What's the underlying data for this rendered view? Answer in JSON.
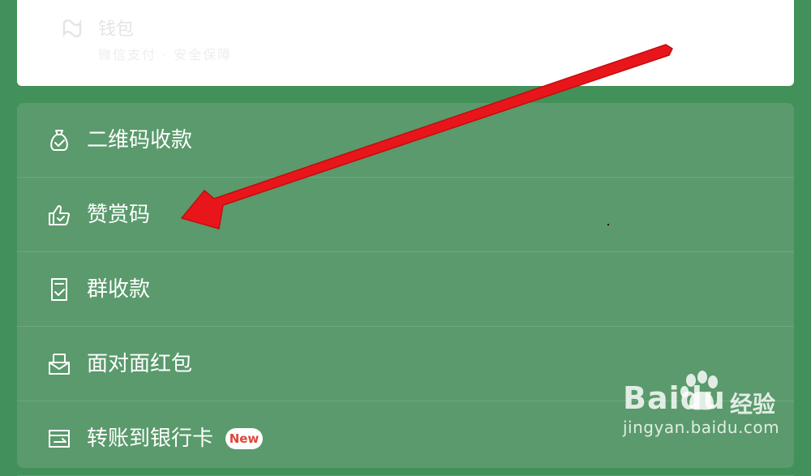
{
  "top_card": {
    "title": "钱包",
    "subtitle": "微信支付  ·  安全保障"
  },
  "menu": {
    "items": [
      {
        "label": "二维码收款",
        "icon": "money-bag-icon"
      },
      {
        "label": "赞赏码",
        "icon": "thumbs-up-icon"
      },
      {
        "label": "群收款",
        "icon": "receipt-check-icon"
      },
      {
        "label": "面对面红包",
        "icon": "red-envelope-icon"
      },
      {
        "label": "转账到银行卡",
        "icon": "bank-transfer-icon",
        "badge": "New"
      }
    ]
  },
  "colors": {
    "background": "#42915a",
    "menu_card": "#5a9a6c",
    "arrow": "#e8161a",
    "badge_text": "#e0463a"
  },
  "watermark": {
    "logo": "Baidu",
    "cn": "经验",
    "url": "jingyan.baidu.com"
  }
}
